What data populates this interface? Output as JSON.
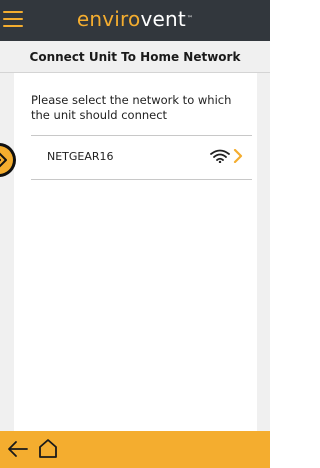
{
  "header": {
    "logo_part1": "enviro",
    "logo_part2": "vent",
    "logo_part3": "",
    "trademark": "™"
  },
  "page": {
    "title": "Connect Unit To Home Network",
    "instruction": "Please select the network to which the unit should connect"
  },
  "networks": [
    {
      "ssid": "NETGEAR16",
      "signal_icon": "wifi-icon",
      "action_icon": "chevron-right-icon"
    }
  ],
  "icons": {
    "menu": "hamburger-menu-icon",
    "back": "arrow-left-icon",
    "home": "home-icon",
    "side_tab": "double-chevron-right-icon"
  },
  "colors": {
    "header_bg": "#32373d",
    "accent": "#f4ad2f",
    "page_bg": "#f0f0f0",
    "card_bg": "#ffffff"
  }
}
